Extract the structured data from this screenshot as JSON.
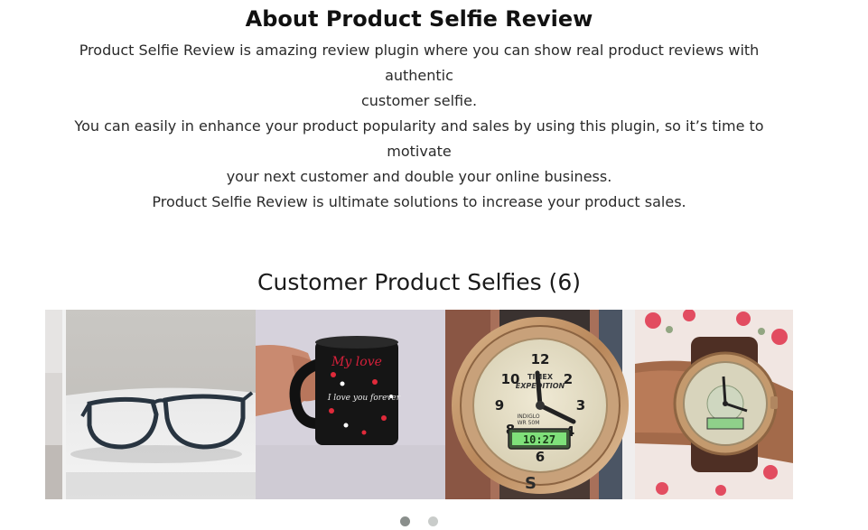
{
  "about": {
    "title": "About Product Selfie Review",
    "paragraph1_line1": "Product Selfie Review is amazing review plugin where you can show real product reviews with authentic",
    "paragraph1_line2": "customer selfie.",
    "paragraph2_line1": "You can easily in enhance your product popularity and sales by using this plugin, so it’s time to motivate",
    "paragraph2_line2": "your next customer and double your online business.",
    "paragraph3": "Product Selfie Review is ultimate solutions to increase your product sales."
  },
  "selfies": {
    "title": "Customer Product Selfies (6)",
    "images": [
      {
        "icon": "cropped-selfie-image"
      },
      {
        "icon": "eyeglasses-selfie-image"
      },
      {
        "icon": "mug-selfie-image",
        "mug_text": "My love",
        "mug_text2": "I love you forever"
      },
      {
        "icon": "timex-watch-selfie-image",
        "brand": "TIMEX",
        "model": "EXPEDITION",
        "sub": "INDIGLO",
        "wr": "WR 50M",
        "digital": "10:27"
      },
      {
        "icon": "wrist-watch-selfie-image"
      }
    ],
    "pagination": {
      "active_index": 0,
      "pages": 2
    },
    "colors": {
      "dot_active": "#8a8f8c",
      "dot_inactive": "#c9ccca"
    }
  }
}
